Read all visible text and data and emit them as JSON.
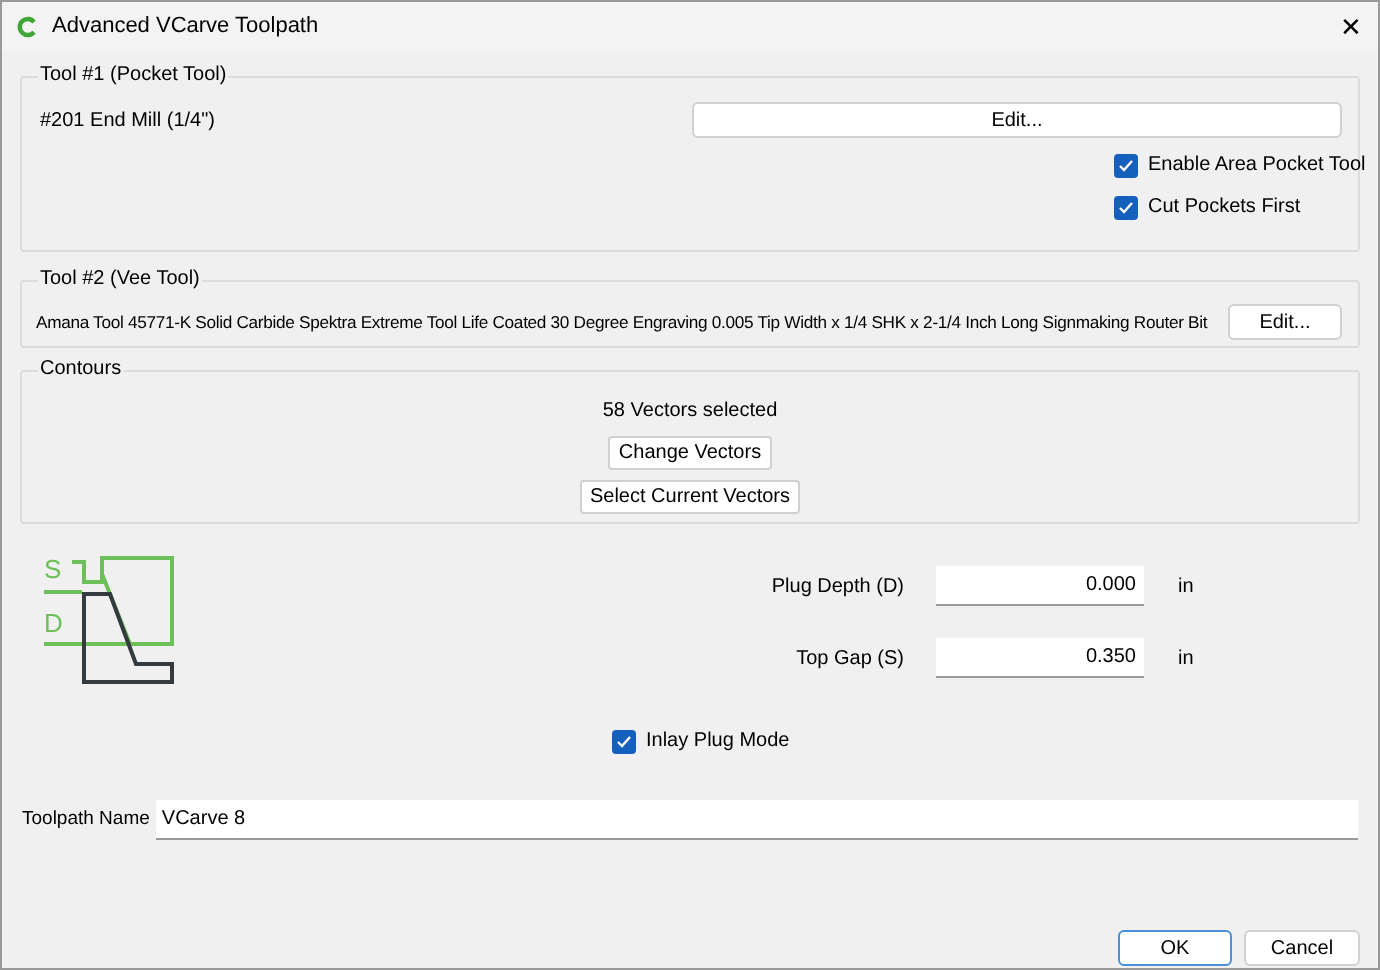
{
  "window": {
    "title": "Advanced VCarve Toolpath",
    "close": "✕"
  },
  "tool1": {
    "legend": "Tool #1 (Pocket Tool)",
    "name": "#201 End Mill (1/4\")",
    "edit": "Edit...",
    "options": [
      {
        "label": "Enable Area Pocket Tool",
        "checked": true
      },
      {
        "label": "Cut Pockets First",
        "checked": true
      }
    ]
  },
  "tool2": {
    "legend": "Tool #2 (Vee Tool)",
    "name": "Amana Tool 45771-K Solid Carbide Spektra Extreme Tool Life Coated 30 Degree Engraving 0.005 Tip Width x 1/4 SHK x 2-1/4 Inch Long Signmaking Router Bit",
    "edit": "Edit..."
  },
  "contours": {
    "legend": "Contours",
    "status": "58 Vectors selected",
    "buttons": [
      "Change Vectors",
      "Select Current Vectors"
    ]
  },
  "diagram": {
    "labels": [
      "S",
      "D"
    ]
  },
  "fields": [
    {
      "label": "Plug Depth (D)",
      "value": "0.000",
      "unit": "in"
    },
    {
      "label": "Top Gap (S)",
      "value": "0.350",
      "unit": "in"
    }
  ],
  "inlay": {
    "label": "Inlay Plug Mode",
    "checked": true
  },
  "toolpath_name": {
    "label": "Toolpath Name",
    "value": "VCarve 8"
  },
  "buttons": [
    "OK",
    "Cancel"
  ]
}
